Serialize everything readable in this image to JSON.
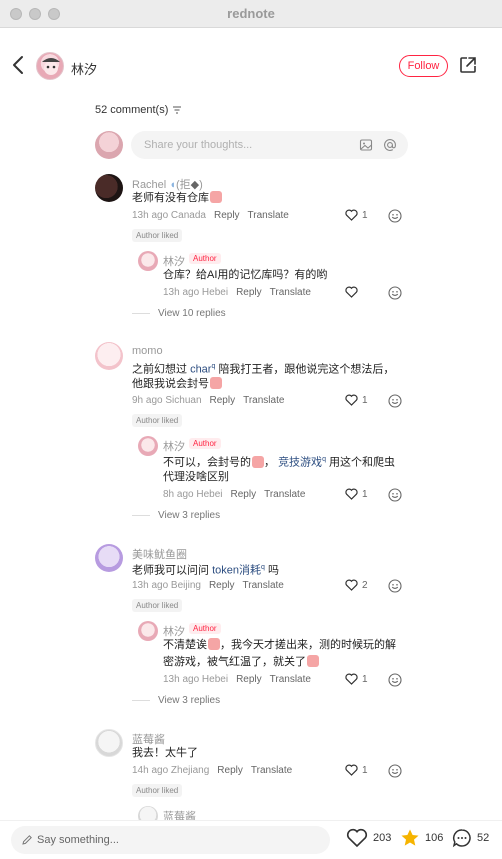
{
  "window": {
    "title": "rednote"
  },
  "header": {
    "author_name": "林汐",
    "follow_label": "Follow"
  },
  "comments_section": {
    "count_label": "52 comment(s)",
    "share_placeholder": "Share your thoughts..."
  },
  "labels": {
    "reply": "Reply",
    "translate": "Translate",
    "author_liked": "Author liked",
    "author_badge": "Author"
  },
  "comments": [
    {
      "user": "Rachel",
      "user_suffix": "(拒",
      "text": "老师有没有仓库",
      "meta": "13h ago Canada",
      "likes": "1",
      "reply": {
        "user": "林汐",
        "text": "仓库？给AI用的记忆库吗？有的哟",
        "meta": "13h ago Hebei",
        "likes": ""
      },
      "view_replies": "View 10 replies"
    },
    {
      "user": "momo",
      "text_line1_a": "之前幻想过",
      "text_link": "char",
      "text_line1_b": "陪我打王者，跟他说完这个想法后，",
      "text_line2": "他跟我说会封号",
      "meta": "9h ago Sichuan",
      "likes": "1",
      "reply": {
        "user": "林汐",
        "text_line1_a": "不可以，会封号的",
        "text_link": "竞技游戏",
        "text_line1_b": "用这个和爬虫",
        "text_line2": "代理没啥区别",
        "meta": "8h ago Hebei",
        "likes": "1"
      },
      "view_replies": "View 3 replies"
    },
    {
      "user": "美味鱿鱼圈",
      "text_a": "老师我可以问问",
      "text_link": "token消耗",
      "text_b": "吗",
      "meta": "13h ago Beijing",
      "likes": "2",
      "reply": {
        "user": "林汐",
        "text_line1": "不清楚诶",
        "text_line1_b": "，我今天才搓出来，测的时候玩的解",
        "text_line2": "密游戏，被气红温了，就关了",
        "meta": "13h ago Hebei",
        "likes": "1"
      },
      "view_replies": "View 3 replies"
    },
    {
      "user": "蓝莓酱",
      "text": "我去！太牛了",
      "meta": "14h ago Zhejiang",
      "likes": "1",
      "reply_user_partial": "蓝莓酱"
    }
  ],
  "bottom_bar": {
    "say_placeholder": "Say something...",
    "likes": "203",
    "collects": "106",
    "comments": "52"
  },
  "colors": {
    "accent": "#ff2442",
    "star": "#f6b400",
    "link": "#2c4d80"
  }
}
